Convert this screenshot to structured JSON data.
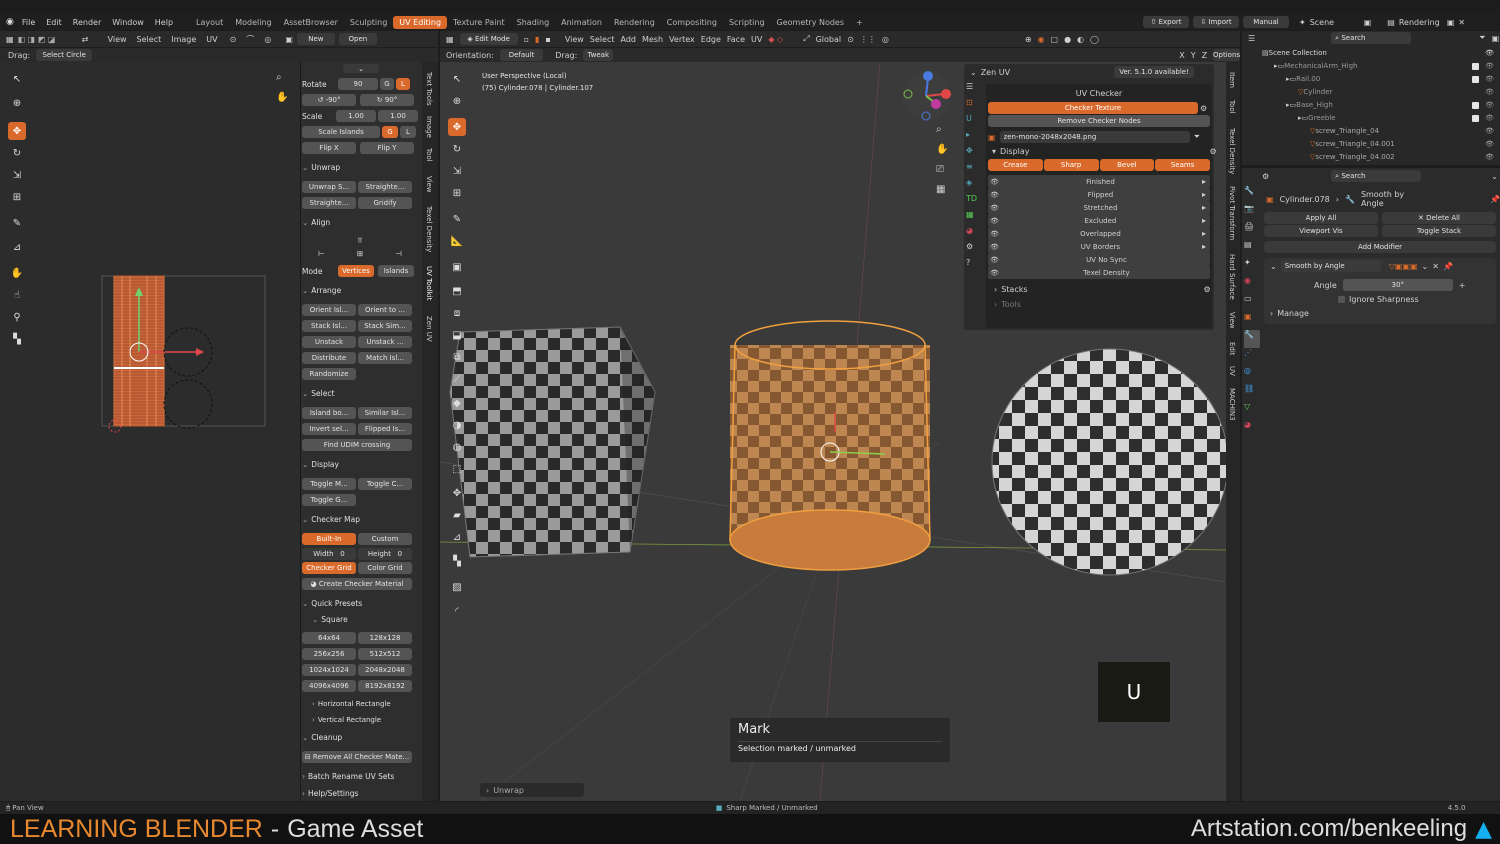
{
  "menubar": {
    "items": [
      "File",
      "Edit",
      "Render",
      "Window",
      "Help"
    ],
    "workspaces": [
      "Layout",
      "Modeling",
      "AssetBrowser",
      "Sculpting",
      "UV Editing",
      "Texture Paint",
      "Shading",
      "Animation",
      "Rendering",
      "Compositing",
      "Scripting",
      "Geometry Nodes"
    ],
    "active_workspace": "UV Editing",
    "export": "Export",
    "import": "Import",
    "manual": "Manual",
    "scene": "Scene",
    "render_layer": "Rendering"
  },
  "uv_editor": {
    "menu": [
      "View",
      "Select",
      "Image",
      "UV"
    ],
    "new": "New",
    "open": "Open",
    "drag_label": "Drag:",
    "drag_value": "Select Circle"
  },
  "uv_panel": {
    "rotate_label": "Rotate",
    "rotate_value": "90",
    "rot_g": "G",
    "rot_l": "L",
    "rot_neg": "-90°",
    "rot_pos": "90°",
    "scale_label": "Scale",
    "scale_x": "1.00",
    "scale_y": "1.00",
    "scale_islands": "Scale Islands",
    "si_g": "G",
    "si_l": "L",
    "flip_x": "Flip X",
    "flip_y": "Flip Y",
    "unwrap_title": "Unwrap",
    "unwrap_btns": [
      "Unwrap S...",
      "Straighte...",
      "Straighte...",
      "Gridify"
    ],
    "align_title": "Align",
    "mode_label": "Mode",
    "mode_vertices": "Vertices",
    "mode_islands": "Islands",
    "arrange_title": "Arrange",
    "arrange_btns": [
      "Orient Isl...",
      "Orient to ...",
      "Stack Isl...",
      "Stack Sim...",
      "Unstack",
      "Unstack ...",
      "Distribute",
      "Match Isl...",
      "Randomize"
    ],
    "select_title": "Select",
    "select_btns": [
      "Island bo...",
      "Similar Isl...",
      "Invert sel...",
      "Flipped Is...",
      "Find UDIM crossing"
    ],
    "display_title": "Display",
    "display_btns": [
      "Toggle M...",
      "Toggle C...",
      "Toggle G..."
    ],
    "checker_title": "Checker Map",
    "builtin": "Built-In",
    "custom": "Custom",
    "width_label": "Width",
    "width_val": "0",
    "height_label": "Height",
    "height_val": "0",
    "checker_grid": "Checker Grid",
    "color_grid": "Color Grid",
    "create_mat": "Create Checker Material",
    "presets_title": "Quick Presets",
    "square": "Square",
    "sizes": [
      "64x64",
      "128x128",
      "256x256",
      "512x512",
      "1024x1024",
      "2048x2048",
      "4096x4096",
      "8192x8192"
    ],
    "horizontal": "Horizontal Rectangle",
    "vertical": "Vertical Rectangle",
    "cleanup_title": "Cleanup",
    "remove_all": "Remove All Checker Mate...",
    "batch_rename": "Batch Rename UV Sets",
    "help": "Help/Settings"
  },
  "uv_vtabs": [
    "Text Tools",
    "Image",
    "Tool",
    "View",
    "Texel Density",
    "UV Toolkit",
    "Zen UV"
  ],
  "viewport": {
    "mode": "Edit Mode",
    "menu": [
      "View",
      "Select",
      "Add",
      "Mesh",
      "Vertex",
      "Edge",
      "Face",
      "UV"
    ],
    "transform": "Global",
    "orientation_label": "Orientation:",
    "orientation_value": "Default",
    "drag_label": "Drag:",
    "drag_value": "Tweak",
    "options": "Options",
    "axes": [
      "X",
      "Y",
      "Z"
    ],
    "perspective": "User Perspective (Local)",
    "object_info": "(75) Cylinder.078 | Cylinder.107",
    "key_overlay": "U",
    "op_title": "Mark",
    "op_desc": "Selection marked / unmarked",
    "last_op": "Unwrap"
  },
  "zen_uv": {
    "title": "Zen UV",
    "version": "Ver. 5.1.0 available!",
    "checker_header": "UV Checker",
    "checker_texture": "Checker Texture",
    "remove_nodes": "Remove Checker Nodes",
    "texture_file": "zen-mono-2048x2048.png",
    "display": "Display",
    "modes": [
      "Crease",
      "Sharp",
      "Bevel",
      "Seams"
    ],
    "rows": [
      "Finished",
      "Flipped",
      "Stretched",
      "Excluded",
      "Overlapped",
      "UV Borders",
      "UV No Sync",
      "Texel Density"
    ],
    "stacks": "Stacks",
    "tools": "Tools"
  },
  "view_vtabs": [
    "Item",
    "Tool",
    "Texel Density",
    "Pivot Transform",
    "Hard Surface",
    "View",
    "Edit",
    "UV",
    "MACHIN3"
  ],
  "outliner": {
    "search": "Search",
    "items": [
      {
        "name": "Scene Collection",
        "indent": 0
      },
      {
        "name": "MechanicalArm_High",
        "indent": 1
      },
      {
        "name": "Rail.00",
        "indent": 2
      },
      {
        "name": "Cylinder",
        "indent": 3
      },
      {
        "name": "Base_High",
        "indent": 2
      },
      {
        "name": "Greeble",
        "indent": 3
      },
      {
        "name": "screw_Triangle_04",
        "indent": 4
      },
      {
        "name": "screw_Triangle_04.001",
        "indent": 4
      },
      {
        "name": "screw_Triangle_04.002",
        "indent": 4
      }
    ]
  },
  "properties": {
    "search": "Search",
    "object": "Cylinder.078",
    "modifier_crumb": "Smooth by Angle",
    "apply_all": "Apply All",
    "delete_all": "Delete All",
    "viewport_vis": "Viewport Vis",
    "toggle_stack": "Toggle Stack",
    "add_modifier": "Add Modifier",
    "modifier_name": "Smooth by Angle",
    "angle_label": "Angle",
    "angle_value": "30°",
    "ignore_sharp": "Ignore Sharpness",
    "manage": "Manage"
  },
  "statusbar": {
    "left": "Pan View",
    "center": "Sharp Marked / Unmarked",
    "version": "4.5.0"
  },
  "banner": {
    "title": "LEARNING BLENDER",
    "subtitle": "Game Asset",
    "url": "Artstation.com/benkeeling"
  },
  "colors": {
    "accent": "#d96a2b",
    "banner_title": "#e8892f",
    "panel": "#303030",
    "header": "#252525"
  }
}
